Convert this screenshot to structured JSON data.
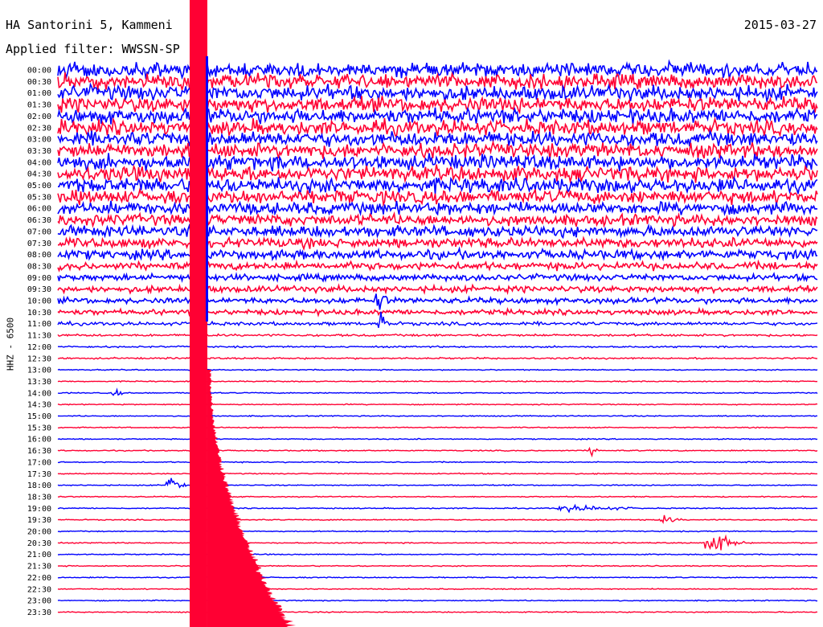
{
  "header": {
    "station": "HA Santorini 5, Kammeni",
    "filter": "Applied filter: WWSSN-SP",
    "date": "2015-03-27",
    "channel": "HHZ - 6500"
  },
  "chart_data": {
    "type": "line",
    "title": "HA Santorini 5, Kammeni",
    "subtitle": "Applied filter: WWSSN-SP",
    "date": "2015-03-27",
    "ylabel": "HHZ - 6500",
    "xlabel": "",
    "row_labels": [
      "00:00",
      "00:30",
      "01:00",
      "01:30",
      "02:00",
      "02:30",
      "03:00",
      "03:30",
      "04:00",
      "04:30",
      "05:00",
      "05:30",
      "06:00",
      "06:30",
      "07:00",
      "07:30",
      "08:00",
      "08:30",
      "09:00",
      "09:30",
      "10:00",
      "10:30",
      "11:00",
      "11:30",
      "12:00",
      "12:30",
      "13:00",
      "13:30",
      "14:00",
      "14:30",
      "15:00",
      "15:30",
      "16:00",
      "16:30",
      "17:00",
      "17:30",
      "18:00",
      "18:30",
      "19:00",
      "19:30",
      "20:00",
      "20:30",
      "21:00",
      "21:30",
      "22:00",
      "22:30",
      "23:00",
      "23:30"
    ],
    "x_range_minutes": [
      0,
      30
    ],
    "series_colors": [
      "#0000ff",
      "#ff0033"
    ],
    "noise_amplitude": [
      30,
      30,
      30,
      28,
      28,
      28,
      26,
      26,
      26,
      24,
      24,
      22,
      20,
      18,
      18,
      16,
      15,
      12,
      10,
      10,
      9,
      8,
      5,
      3,
      2,
      2,
      1,
      1,
      1,
      1,
      1,
      1,
      1,
      1,
      1,
      1,
      1,
      1,
      1,
      1,
      1,
      1,
      1,
      1,
      1,
      1,
      1,
      1
    ],
    "events": [
      {
        "row": "00:00",
        "minute": 5.2,
        "amplitude": 400,
        "duration_min": 1.2,
        "note": "saturated"
      },
      {
        "row": "00:30",
        "minute": 5.2,
        "amplitude": 400,
        "duration_min": 1.2,
        "note": "saturated"
      },
      {
        "row": "01:00",
        "minute": 5.2,
        "amplitude": 400,
        "duration_min": 1.2,
        "note": "saturated"
      },
      {
        "row": "01:30",
        "minute": 5.2,
        "amplitude": 400,
        "duration_min": 1.2,
        "note": "saturated"
      },
      {
        "row": "02:00",
        "minute": 5.2,
        "amplitude": 400,
        "duration_min": 1.2,
        "note": "saturated"
      },
      {
        "row": "10:00",
        "minute": 12.6,
        "amplitude": 22,
        "duration_min": 0.6
      },
      {
        "row": "11:00",
        "minute": 12.7,
        "amplitude": 28,
        "duration_min": 0.5
      },
      {
        "row": "14:00",
        "minute": 2.2,
        "amplitude": 12,
        "duration_min": 0.4
      },
      {
        "row": "16:30",
        "minute": 21.0,
        "amplitude": 10,
        "duration_min": 0.5
      },
      {
        "row": "18:00",
        "minute": 4.3,
        "amplitude": 28,
        "duration_min": 0.8
      },
      {
        "row": "19:00",
        "minute": 19.8,
        "amplitude": 6,
        "duration_min": 4.0
      },
      {
        "row": "19:30",
        "minute": 23.8,
        "amplitude": 8,
        "duration_min": 1.0
      },
      {
        "row": "20:30",
        "minute": 25.6,
        "amplitude": 26,
        "duration_min": 1.5
      }
    ]
  }
}
